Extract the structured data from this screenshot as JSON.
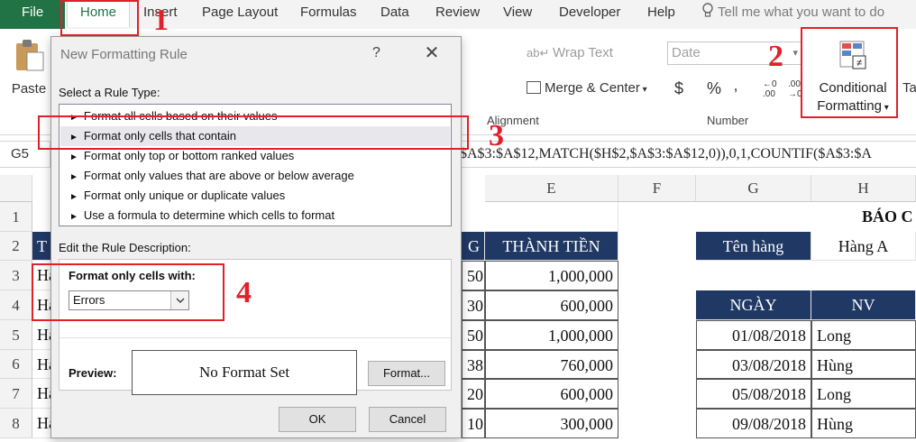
{
  "ribbon": {
    "tabs": {
      "file": "File",
      "home": "Home",
      "insert": "Insert",
      "page_layout": "Page Layout",
      "formulas": "Formulas",
      "data": "Data",
      "review": "Review",
      "view": "View",
      "developer": "Developer",
      "help": "Help"
    },
    "tell_me": "Tell me what you want to do",
    "paste": "Paste",
    "wrap_text": "Wrap Text",
    "merge_center": "Merge & Center",
    "alignment_group": "Alignment",
    "number_format": "Date",
    "number_group": "Number",
    "currency_symbol": "$",
    "percent_symbol": "%",
    "comma_symbol": "‚",
    "conditional_formatting_line1": "Conditional",
    "conditional_formatting_line2": "Formatting",
    "format_as_table_cut": "Ta",
    "accent_color": "#217346"
  },
  "formula_bar": {
    "name_box": "G5",
    "formula": "$A$3:$A$12,MATCH($H$2,$A$3:$A$12,0)),0,1,COUNTIF($A$3:$A"
  },
  "sheet": {
    "col_headers": [
      "E",
      "F",
      "G",
      "H"
    ],
    "row_headers": [
      "1",
      "2",
      "3",
      "4",
      "5",
      "6",
      "7",
      "8"
    ],
    "title_partial": "BÁO C",
    "header_qty_partial": "G",
    "header_total": "THÀNH TIỀN",
    "ten_hang_label": "Tên hàng",
    "ten_hang_value": "Hàng A",
    "ngay_header": "NGÀY",
    "nv_header": "NV",
    "a_col_partial": [
      "T",
      "Hà",
      "Hà",
      "Hà",
      "Hà",
      "Hà",
      "Hà"
    ],
    "rows": [
      {
        "qty": "50",
        "total": "1,000,000"
      },
      {
        "qty": "30",
        "total": "600,000"
      },
      {
        "qty": "50",
        "total": "1,000,000"
      },
      {
        "qty": "38",
        "total": "760,000"
      },
      {
        "qty": "20",
        "total": "600,000"
      },
      {
        "qty": "10",
        "total": "300,000"
      }
    ],
    "date_rows": [
      {
        "date": "01/08/2018",
        "nv": "Long"
      },
      {
        "date": "03/08/2018",
        "nv": "Hùng"
      },
      {
        "date": "05/08/2018",
        "nv": "Long"
      },
      {
        "date": "09/08/2018",
        "nv": "Hùng"
      }
    ],
    "header_fill_color": "#1f3864"
  },
  "dialog": {
    "title": "New Formatting Rule",
    "help": "?",
    "select_rule_type_label": "Select a Rule Type:",
    "rule_types": [
      "Format all cells based on their values",
      "Format only cells that contain",
      "Format only top or bottom ranked values",
      "Format only values that are above or below average",
      "Format only unique or duplicate values",
      "Use a formula to determine which cells to format"
    ],
    "selected_rule_index": 1,
    "edit_description_label": "Edit the Rule Description:",
    "format_only_cells_with": "Format only cells with:",
    "condition_value": "Errors",
    "preview_label": "Preview:",
    "preview_text": "No Format Set",
    "format_button": "Format...",
    "ok_button": "OK",
    "cancel_button": "Cancel"
  },
  "annotations": {
    "step1": "1",
    "step2": "2",
    "step3": "3",
    "step4": "4",
    "highlight_color": "#e0202a"
  }
}
